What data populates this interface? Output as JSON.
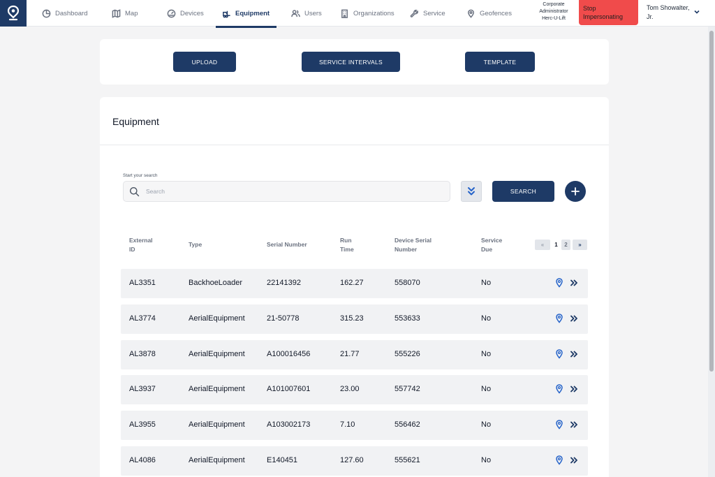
{
  "nav": {
    "items": [
      {
        "id": "dashboard",
        "label": "Dashboard",
        "icon": "pie-chart-icon"
      },
      {
        "id": "map",
        "label": "Map",
        "icon": "map-icon"
      },
      {
        "id": "devices",
        "label": "Devices",
        "icon": "gauge-icon"
      },
      {
        "id": "equipment",
        "label": "Equipment",
        "icon": "forklift-icon",
        "active": true
      },
      {
        "id": "users",
        "label": "Users",
        "icon": "users-icon"
      },
      {
        "id": "organizations",
        "label": "Organizations",
        "icon": "building-icon"
      },
      {
        "id": "service",
        "label": "Service",
        "icon": "wrench-icon"
      },
      {
        "id": "geofences",
        "label": "Geofences",
        "icon": "location-pin-icon"
      }
    ],
    "role_line1": "Corporate",
    "role_line2": "Administrator",
    "role_line3": "Herc-U-Lift",
    "stop_impersonating_line1": "Stop",
    "stop_impersonating_line2": "Impersonating",
    "user_name_line1": "Tom Showalter,",
    "user_name_line2": "Jr."
  },
  "actions": {
    "upload_label": "UPLOAD",
    "service_intervals_label": "SERVICE INTERVALS",
    "template_label": "TEMPLATE"
  },
  "equipment": {
    "title": "Equipment",
    "search_label": "Start your search",
    "search_placeholder": "Search",
    "search_button": "SEARCH",
    "columns": {
      "external_id_l1": "External",
      "external_id_l2": "ID",
      "type": "Type",
      "serial_number": "Serial Number",
      "run_time_l1": "Run",
      "run_time_l2": "Time",
      "device_serial_l1": "Device Serial",
      "device_serial_l2": "Number",
      "service_due_l1": "Service",
      "service_due_l2": "Due"
    },
    "pagination": {
      "first": "«",
      "pages": [
        "1",
        "2"
      ],
      "last": "»"
    },
    "rows": [
      {
        "external_id": "AL3351",
        "type": "BackhoeLoader",
        "serial_number": "22141392",
        "run_time": "162.27",
        "device_serial": "558070",
        "service_due": "No"
      },
      {
        "external_id": "AL3774",
        "type": "AerialEquipment",
        "serial_number": "21-50778",
        "run_time": "315.23",
        "device_serial": "553633",
        "service_due": "No"
      },
      {
        "external_id": "AL3878",
        "type": "AerialEquipment",
        "serial_number": "A100016456",
        "run_time": "21.77",
        "device_serial": "555226",
        "service_due": "No"
      },
      {
        "external_id": "AL3937",
        "type": "AerialEquipment",
        "serial_number": "A101007601",
        "run_time": "23.00",
        "device_serial": "557742",
        "service_due": "No"
      },
      {
        "external_id": "AL3955",
        "type": "AerialEquipment",
        "serial_number": "A103002173",
        "run_time": "7.10",
        "device_serial": "556462",
        "service_due": "No"
      },
      {
        "external_id": "AL4086",
        "type": "AerialEquipment",
        "serial_number": "E140451",
        "run_time": "127.60",
        "device_serial": "555621",
        "service_due": "No"
      }
    ]
  },
  "colors": {
    "primary": "#1e3a66",
    "danger": "#f04b4b",
    "row_bg": "#f1f2f4",
    "page_bg": "#f4f4f5"
  }
}
